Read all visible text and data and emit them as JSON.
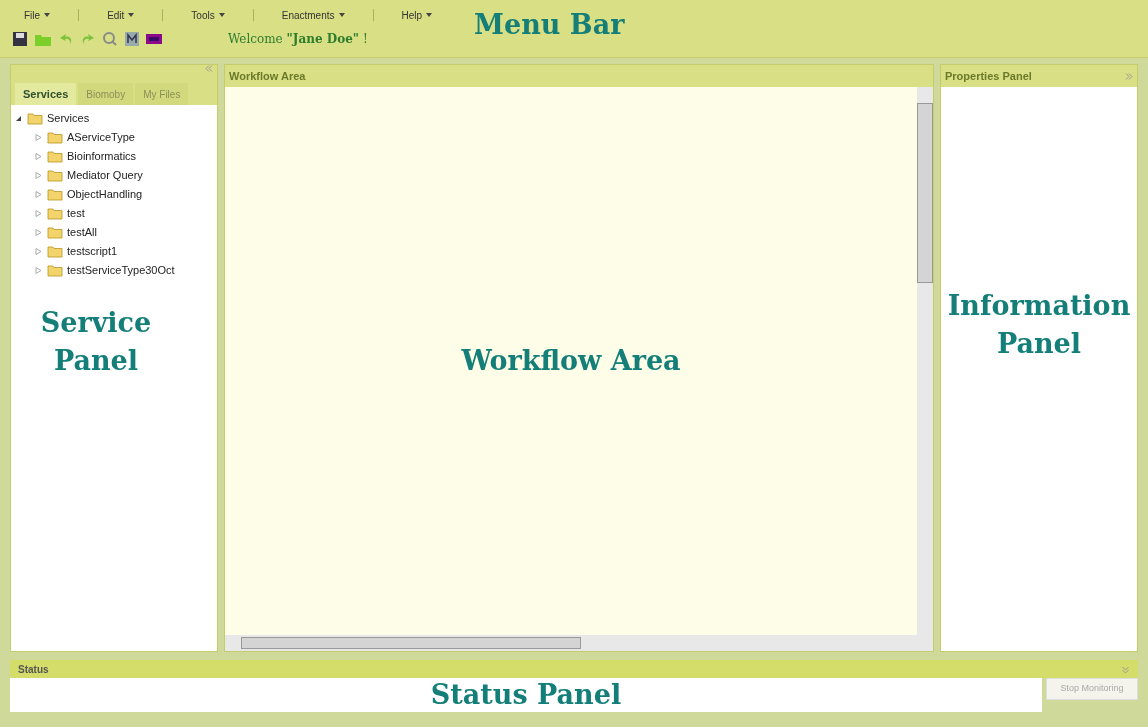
{
  "menu_bar": {
    "items": [
      "File",
      "Edit",
      "Tools",
      "Enactments",
      "Help"
    ],
    "welcome": "Welcome **\"Jane Doe\"** !",
    "annotation": "Menu Bar"
  },
  "service_panel": {
    "tabs": [
      {
        "label": "Services",
        "selected": true
      },
      {
        "label": "Biomoby",
        "selected": false
      },
      {
        "label": "My Files",
        "selected": false
      }
    ],
    "tree": [
      {
        "label": "Services",
        "expanded": true,
        "children": [
          {
            "label": "AServiceType",
            "expanded": false
          },
          {
            "label": "Bioinformatics",
            "expanded": false
          },
          {
            "label": "Mediator Query",
            "expanded": false
          },
          {
            "label": "ObjectHandling",
            "expanded": false
          },
          {
            "label": "test",
            "expanded": false
          },
          {
            "label": "testAll",
            "expanded": false
          },
          {
            "label": "testscript1",
            "expanded": false
          },
          {
            "label": "testServiceType30Oct",
            "expanded": false
          }
        ]
      }
    ],
    "annotation": "Service Panel"
  },
  "workflow_area": {
    "title": "Workflow Area",
    "annotation": "Workflow Area"
  },
  "properties_panel": {
    "title": "Properties Panel",
    "annotation": "Information Panel"
  },
  "status_panel": {
    "title": "Status",
    "annotation": "Status Panel",
    "button": "Stop Monitoring"
  }
}
